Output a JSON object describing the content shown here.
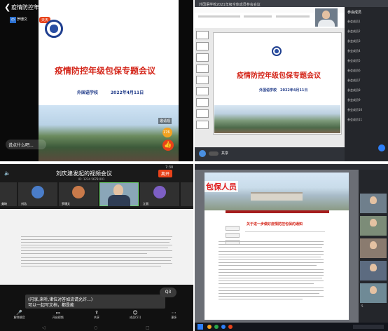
{
  "q1": {
    "title": "疫情防控年级包保专题会议 2020级",
    "badge_a": "中",
    "badge_b": "罗珊文",
    "badge_c": "天天",
    "slide_title": "疫情防控年级包保专题会议",
    "school": "外国语学校",
    "date": "2022年4月11日",
    "comment_placeholder": "说点什么吧...",
    "side_label": "邀请观",
    "count": "176",
    "colors": {
      "accent": "#e8421a",
      "title": "#d4261a"
    }
  },
  "q2": {
    "window_title": "外国语学校2021年级全体成员参会会议",
    "slide_title": "疫情防控年级包保专题会议",
    "school": "外国语学校",
    "date": "2022年4月11日",
    "participants_title": "参会成员",
    "participants": [
      "参会成员1",
      "参会成员2",
      "参会成员3",
      "参会成员4",
      "参会成员5",
      "参会成员6",
      "参会成员7",
      "参会成员8",
      "参会成员9",
      "参会成员10",
      "参会成员11"
    ],
    "bottom_left": "共享"
  },
  "q3": {
    "status_time": "7:30",
    "meeting_title": "刘庆建发起的视频会议",
    "meeting_subtitle": "ID: 1234 5678 001",
    "leave_label": "离开",
    "names": [
      "刘浩",
      "罗珊文",
      "江丽"
    ],
    "left_name": "美琦",
    "subtitle_line1": "(闪享,来听,诸位对答如流请允许...)",
    "subtitle_line2": "可以一起写文档，都是能",
    "toolbar": [
      "解除静音",
      "开启视频",
      "共享",
      "成员(51)",
      "更多"
    ],
    "float_label": "Q3"
  },
  "q4": {
    "doc_banner": "包保人员",
    "doc_title": "关于进一步做好疫情防控包保的通知",
    "participant_count": "5"
  }
}
